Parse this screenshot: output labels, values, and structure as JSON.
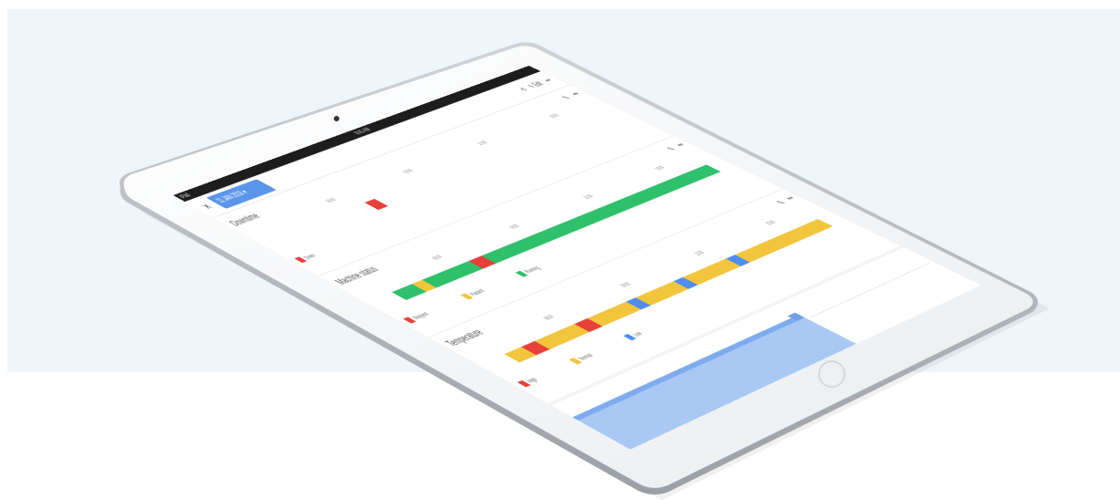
{
  "status_bar": {
    "carrier": "iPad",
    "time": "9:41 AM"
  },
  "toolbar": {
    "close_glyph": "✕",
    "date_range": "11 JAN 2016 ▾",
    "history_icon": "history-icon",
    "edit_label": "Edit",
    "more_glyph": "•••"
  },
  "colors": {
    "green": "#2ec06a",
    "yellow": "#f2c53d",
    "red": "#e8413a",
    "blue": "#4d8ef0",
    "chip": "#5b95e9"
  },
  "sections": [
    {
      "title": "Downtime",
      "ticks": [
        "06:00",
        "09:00",
        "12:00",
        "15:00"
      ],
      "legend": [
        {
          "label": "Down",
          "color": "#e8413a"
        }
      ],
      "segments": [
        {
          "share": 0.24,
          "color": "none"
        },
        {
          "share": 0.03,
          "color": "#e8413a"
        },
        {
          "share": 0.73,
          "color": "none"
        }
      ]
    },
    {
      "title": "Machine status",
      "ticks": [
        "06:00",
        "09:00",
        "12:00",
        "15:00"
      ],
      "legend": [
        {
          "label": "Stopped",
          "color": "#e8413a"
        },
        {
          "label": "Paused",
          "color": "#f2c53d"
        },
        {
          "label": "Running",
          "color": "#2ec06a"
        }
      ],
      "segments": [
        {
          "share": 0.06,
          "color": "#2ec06a"
        },
        {
          "share": 0.03,
          "color": "#f2c53d"
        },
        {
          "share": 0.14,
          "color": "#2ec06a"
        },
        {
          "share": 0.04,
          "color": "#e8413a"
        },
        {
          "share": 0.73,
          "color": "#2ec06a"
        }
      ]
    },
    {
      "title": "Temperature",
      "ticks": [
        "06:00",
        "09:00",
        "12:00",
        "15:00"
      ],
      "legend": [
        {
          "label": "High",
          "color": "#e8413a"
        },
        {
          "label": "Normal",
          "color": "#f2c53d"
        },
        {
          "label": "Low",
          "color": "#4d8ef0"
        }
      ],
      "segments": [
        {
          "share": 0.05,
          "color": "#f2c53d"
        },
        {
          "share": 0.04,
          "color": "#e8413a"
        },
        {
          "share": 0.12,
          "color": "#f2c53d"
        },
        {
          "share": 0.04,
          "color": "#e8413a"
        },
        {
          "share": 0.12,
          "color": "#f2c53d"
        },
        {
          "share": 0.03,
          "color": "#4d8ef0"
        },
        {
          "share": 0.12,
          "color": "#f2c53d"
        },
        {
          "share": 0.03,
          "color": "#4d8ef0"
        },
        {
          "share": 0.14,
          "color": "#f2c53d"
        },
        {
          "share": 0.03,
          "color": "#4d8ef0"
        },
        {
          "share": 0.28,
          "color": "#f2c53d"
        }
      ]
    }
  ]
}
